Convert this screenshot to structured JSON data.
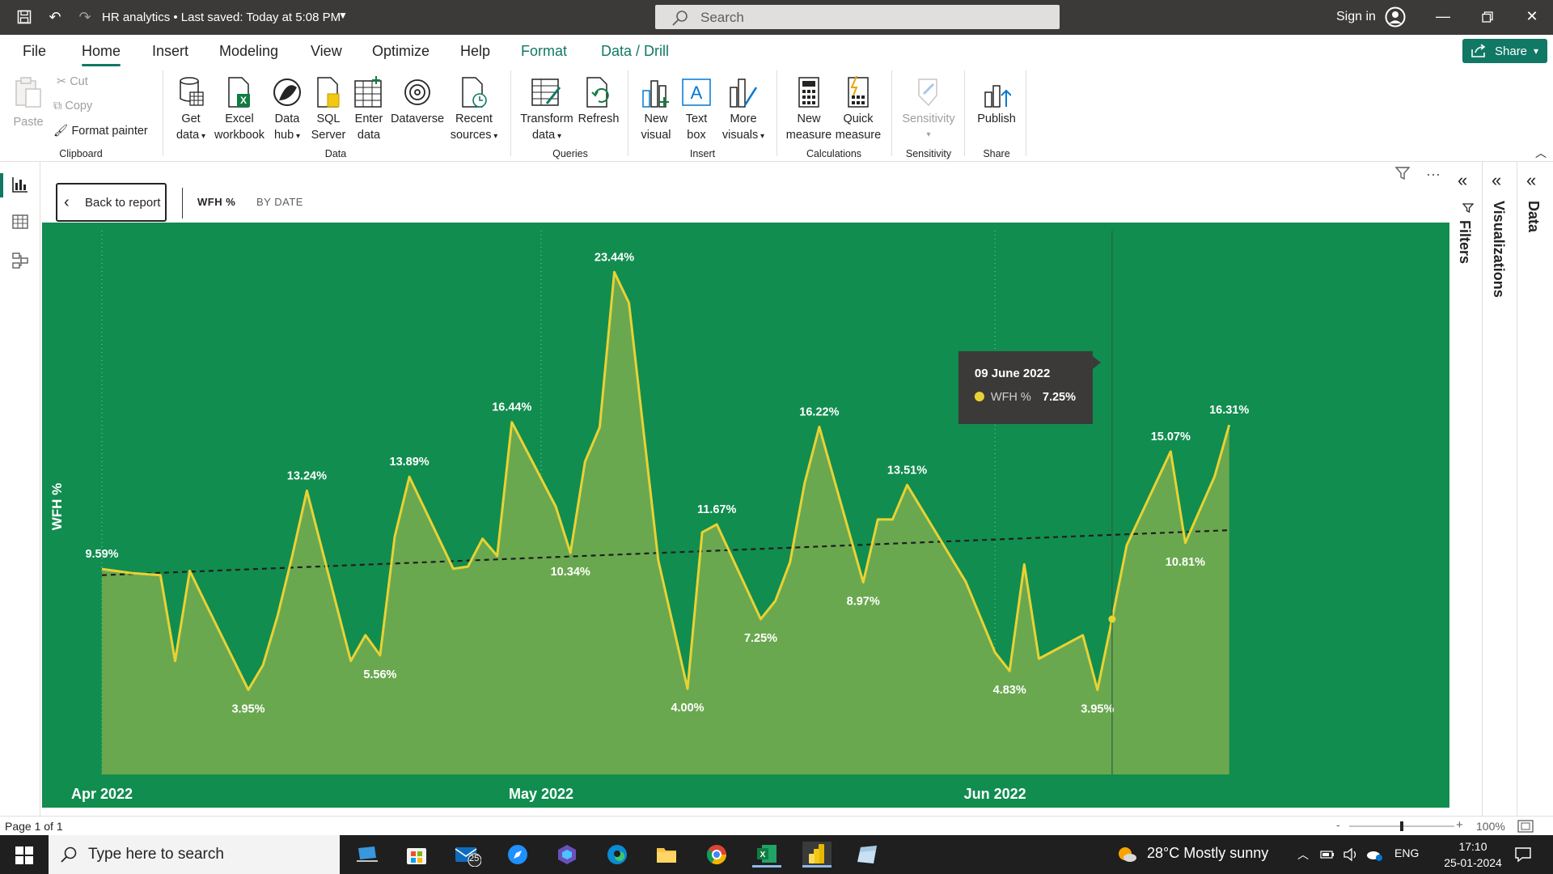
{
  "titlebar": {
    "title": "HR analytics • Last saved: Today at 5:08 PM",
    "search_placeholder": "Search",
    "sign_in": "Sign in"
  },
  "menu": {
    "tabs": [
      "File",
      "Home",
      "Insert",
      "Modeling",
      "View",
      "Optimize",
      "Help",
      "Format",
      "Data / Drill"
    ],
    "active_tab": "Home",
    "share_label": "Share"
  },
  "ribbon": {
    "clipboard": {
      "paste": "Paste",
      "cut": "Cut",
      "copy": "Copy",
      "format_painter": "Format painter",
      "group": "Clipboard"
    },
    "data": {
      "get_data": [
        "Get",
        "data"
      ],
      "excel": [
        "Excel",
        "workbook"
      ],
      "data_hub": [
        "Data",
        "hub"
      ],
      "sql": [
        "SQL",
        "Server"
      ],
      "enter_data": [
        "Enter",
        "data"
      ],
      "dataverse": "Dataverse",
      "recent": [
        "Recent",
        "sources"
      ],
      "group": "Data"
    },
    "queries": {
      "transform": [
        "Transform",
        "data"
      ],
      "refresh": "Refresh",
      "group": "Queries"
    },
    "insert": {
      "new_visual": [
        "New",
        "visual"
      ],
      "text_box": [
        "Text",
        "box"
      ],
      "more_visuals": [
        "More",
        "visuals"
      ],
      "group": "Insert"
    },
    "calculations": {
      "new_measure": [
        "New",
        "measure"
      ],
      "quick_measure": [
        "Quick",
        "measure"
      ],
      "group": "Calculations"
    },
    "sensitivity": {
      "label": "Sensitivity",
      "group": "Sensitivity"
    },
    "share": {
      "publish": "Publish",
      "group": "Share"
    }
  },
  "visual_header": {
    "back": "Back to report",
    "drill_primary": "WFH %",
    "drill_secondary": "BY DATE"
  },
  "chart_data": {
    "type": "area",
    "ylabel": "WFH %",
    "xlabel": "",
    "background_color": "#118d4f",
    "area_color": "#6aa84f",
    "line_color": "#e9d234",
    "trend_line": "dashed",
    "x_ticks": [
      "Apr 2022",
      "May 2022",
      "Jun 2022"
    ],
    "x_start": "2022-04-01",
    "x_end": "2022-06-30",
    "ylim": [
      0,
      25
    ],
    "points": [
      {
        "x": "2022-04-01",
        "y": 9.59
      },
      {
        "x": "2022-04-03",
        "y": 9.4
      },
      {
        "x": "2022-04-05",
        "y": 9.3
      },
      {
        "x": "2022-04-06",
        "y": 5.3
      },
      {
        "x": "2022-04-07",
        "y": 9.5
      },
      {
        "x": "2022-04-08",
        "y": 8.1
      },
      {
        "x": "2022-04-11",
        "y": 3.95
      },
      {
        "x": "2022-04-12",
        "y": 5.1
      },
      {
        "x": "2022-04-13",
        "y": 7.4
      },
      {
        "x": "2022-04-14",
        "y": 10.2
      },
      {
        "x": "2022-04-15",
        "y": 13.24
      },
      {
        "x": "2022-04-18",
        "y": 5.3
      },
      {
        "x": "2022-04-19",
        "y": 6.5
      },
      {
        "x": "2022-04-20",
        "y": 5.56
      },
      {
        "x": "2022-04-21",
        "y": 11.1
      },
      {
        "x": "2022-04-22",
        "y": 13.89
      },
      {
        "x": "2022-04-25",
        "y": 9.6
      },
      {
        "x": "2022-04-26",
        "y": 9.7
      },
      {
        "x": "2022-04-27",
        "y": 11.0
      },
      {
        "x": "2022-04-28",
        "y": 10.2
      },
      {
        "x": "2022-04-29",
        "y": 16.44
      },
      {
        "x": "2022-05-02",
        "y": 12.5
      },
      {
        "x": "2022-05-03",
        "y": 10.34
      },
      {
        "x": "2022-05-04",
        "y": 14.6
      },
      {
        "x": "2022-05-05",
        "y": 16.2
      },
      {
        "x": "2022-05-06",
        "y": 23.44
      },
      {
        "x": "2022-05-07",
        "y": 22.0
      },
      {
        "x": "2022-05-09",
        "y": 10.0
      },
      {
        "x": "2022-05-11",
        "y": 4.0
      },
      {
        "x": "2022-05-12",
        "y": 11.3
      },
      {
        "x": "2022-05-13",
        "y": 11.67
      },
      {
        "x": "2022-05-16",
        "y": 7.25
      },
      {
        "x": "2022-05-17",
        "y": 8.1
      },
      {
        "x": "2022-05-18",
        "y": 9.9
      },
      {
        "x": "2022-05-19",
        "y": 13.6
      },
      {
        "x": "2022-05-20",
        "y": 16.22
      },
      {
        "x": "2022-05-23",
        "y": 8.97
      },
      {
        "x": "2022-05-24",
        "y": 11.9
      },
      {
        "x": "2022-05-25",
        "y": 11.9
      },
      {
        "x": "2022-05-26",
        "y": 13.51
      },
      {
        "x": "2022-05-30",
        "y": 9.0
      },
      {
        "x": "2022-06-01",
        "y": 5.7
      },
      {
        "x": "2022-06-02",
        "y": 4.83
      },
      {
        "x": "2022-06-03",
        "y": 9.8
      },
      {
        "x": "2022-06-04",
        "y": 5.4
      },
      {
        "x": "2022-06-07",
        "y": 6.5
      },
      {
        "x": "2022-06-08",
        "y": 3.95
      },
      {
        "x": "2022-06-09",
        "y": 7.25
      },
      {
        "x": "2022-06-10",
        "y": 10.7
      },
      {
        "x": "2022-06-13",
        "y": 15.07
      },
      {
        "x": "2022-06-14",
        "y": 10.81
      },
      {
        "x": "2022-06-16",
        "y": 13.9
      },
      {
        "x": "2022-06-17",
        "y": 16.31
      }
    ],
    "data_labels": [
      {
        "x": "2022-04-01",
        "text": "9.59%"
      },
      {
        "x": "2022-04-11",
        "text": "3.95%"
      },
      {
        "x": "2022-04-15",
        "text": "13.24%"
      },
      {
        "x": "2022-04-20",
        "text": "5.56%"
      },
      {
        "x": "2022-04-22",
        "text": "13.89%"
      },
      {
        "x": "2022-04-29",
        "text": "16.44%"
      },
      {
        "x": "2022-05-03",
        "text": "10.34%"
      },
      {
        "x": "2022-05-06",
        "text": "23.44%"
      },
      {
        "x": "2022-05-11",
        "text": "4.00%"
      },
      {
        "x": "2022-05-13",
        "text": "11.67%"
      },
      {
        "x": "2022-05-16",
        "text": "7.25%"
      },
      {
        "x": "2022-05-20",
        "text": "16.22%"
      },
      {
        "x": "2022-05-23",
        "text": "8.97%"
      },
      {
        "x": "2022-05-26",
        "text": "13.51%"
      },
      {
        "x": "2022-06-02",
        "text": "4.83%"
      },
      {
        "x": "2022-06-08",
        "text": "3.95%"
      },
      {
        "x": "2022-06-13",
        "text": "15.07%"
      },
      {
        "x": "2022-06-14",
        "text": "10.81%"
      },
      {
        "x": "2022-06-17",
        "text": "16.31%"
      }
    ],
    "trend": {
      "start": 9.3,
      "end": 11.4
    },
    "tooltip": {
      "date": "09 June 2022",
      "series": "WFH %",
      "value": "7.25%",
      "x": "2022-06-09"
    }
  },
  "right_panes": {
    "filters": "Filters",
    "visualizations": "Visualizations",
    "data": "Data"
  },
  "status": {
    "page": "Page 1 of 1",
    "zoom": "100%",
    "zoom_fraction": 0.5
  },
  "taskbar": {
    "search_placeholder": "Type here to search",
    "mail_badge": "25",
    "weather": "28°C  Mostly sunny",
    "lang": "ENG",
    "time": "17:10",
    "date": "25-01-2024"
  }
}
